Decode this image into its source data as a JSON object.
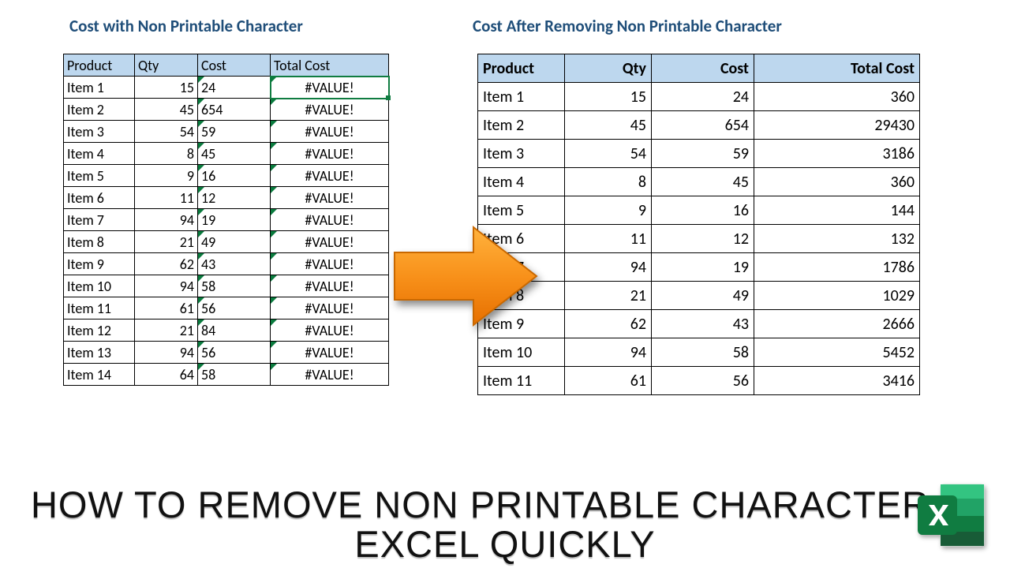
{
  "left": {
    "title": "Cost with Non Printable Character",
    "headers": {
      "product": "Product",
      "qty": "Qty",
      "cost": "Cost",
      "total": "Total Cost"
    },
    "rows": [
      {
        "product": "Item 1",
        "qty": "15",
        "cost": "24",
        "total": "#VALUE!"
      },
      {
        "product": "Item 2",
        "qty": "45",
        "cost": "654",
        "total": "#VALUE!"
      },
      {
        "product": "Item 3",
        "qty": "54",
        "cost": "59",
        "total": "#VALUE!"
      },
      {
        "product": "Item 4",
        "qty": "8",
        "cost": "45",
        "total": "#VALUE!"
      },
      {
        "product": "Item 5",
        "qty": "9",
        "cost": "16",
        "total": "#VALUE!"
      },
      {
        "product": "Item 6",
        "qty": "11",
        "cost": "12",
        "total": "#VALUE!"
      },
      {
        "product": "Item 7",
        "qty": "94",
        "cost": "19",
        "total": "#VALUE!"
      },
      {
        "product": "Item 8",
        "qty": "21",
        "cost": "49",
        "total": "#VALUE!"
      },
      {
        "product": "Item 9",
        "qty": "62",
        "cost": "43",
        "total": "#VALUE!"
      },
      {
        "product": "Item 10",
        "qty": "94",
        "cost": "58",
        "total": "#VALUE!"
      },
      {
        "product": "Item 11",
        "qty": "61",
        "cost": "56",
        "total": "#VALUE!"
      },
      {
        "product": "Item 12",
        "qty": "21",
        "cost": "84",
        "total": "#VALUE!"
      },
      {
        "product": "Item 13",
        "qty": "94",
        "cost": "56",
        "total": "#VALUE!"
      },
      {
        "product": "Item 14",
        "qty": "64",
        "cost": "58",
        "total": "#VALUE!"
      }
    ]
  },
  "right": {
    "title": "Cost After Removing Non Printable Character",
    "headers": {
      "product": "Product",
      "qty": "Qty",
      "cost": "Cost",
      "total": "Total Cost"
    },
    "rows": [
      {
        "product": "Item 1",
        "qty": "15",
        "cost": "24",
        "total": "360"
      },
      {
        "product": "Item 2",
        "qty": "45",
        "cost": "654",
        "total": "29430"
      },
      {
        "product": "Item 3",
        "qty": "54",
        "cost": "59",
        "total": "3186"
      },
      {
        "product": "Item 4",
        "qty": "8",
        "cost": "45",
        "total": "360"
      },
      {
        "product": "Item 5",
        "qty": "9",
        "cost": "16",
        "total": "144"
      },
      {
        "product": "Item 6",
        "qty": "11",
        "cost": "12",
        "total": "132"
      },
      {
        "product": "Item 7",
        "qty": "94",
        "cost": "19",
        "total": "1786"
      },
      {
        "product": "Item 8",
        "qty": "21",
        "cost": "49",
        "total": "1029"
      },
      {
        "product": "Item 9",
        "qty": "62",
        "cost": "43",
        "total": "2666"
      },
      {
        "product": "Item 10",
        "qty": "94",
        "cost": "58",
        "total": "5452"
      },
      {
        "product": "Item 11",
        "qty": "61",
        "cost": "56",
        "total": "3416"
      }
    ]
  },
  "footer": {
    "line1": "HOW TO REMOVE NON PRINTABLE CHARACTER IN",
    "line2": "EXCEL QUICKLY"
  }
}
